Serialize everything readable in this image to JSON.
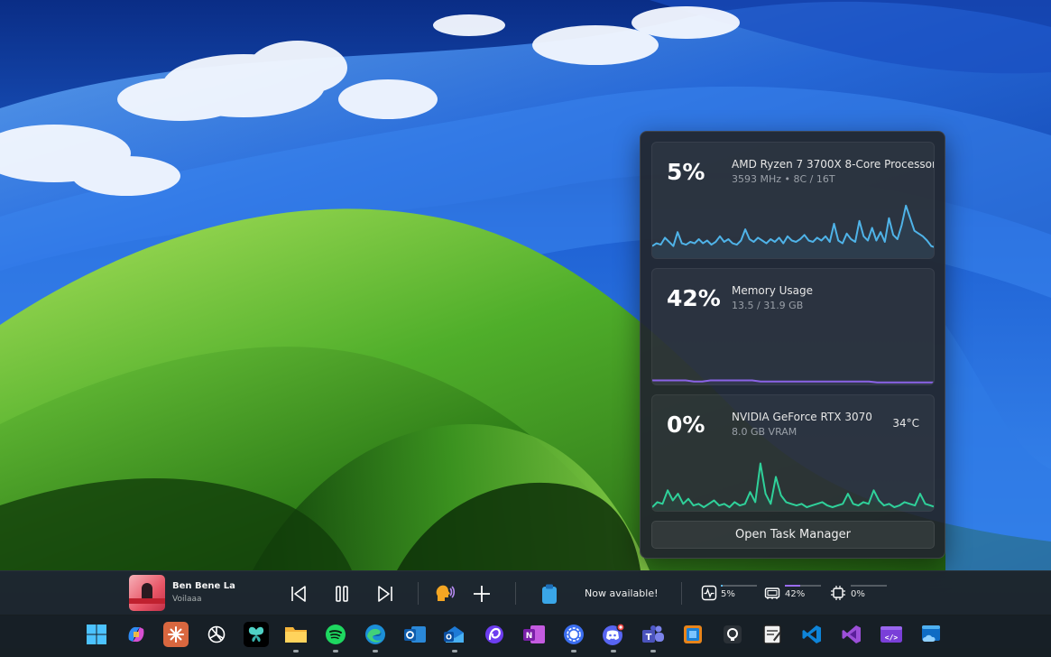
{
  "colors": {
    "cpu_line": "#4fb3e8",
    "mem_line": "#8a63e6",
    "gpu_line": "#2fd19a",
    "accent": "#5bb7f0"
  },
  "performance": {
    "cpu": {
      "percent": "5%",
      "name": "AMD Ryzen 7 3700X 8-Core Processor",
      "details": "3593 MHz  •  8C / 16T",
      "history": [
        6,
        8,
        7,
        12,
        9,
        6,
        16,
        8,
        7,
        9,
        8,
        11,
        8,
        10,
        7,
        9,
        13,
        9,
        11,
        8,
        7,
        10,
        18,
        11,
        9,
        12,
        10,
        8,
        11,
        9,
        12,
        8,
        13,
        10,
        9,
        11,
        14,
        10,
        9,
        12,
        10,
        13,
        9,
        22,
        10,
        8,
        15,
        11,
        9,
        24,
        13,
        10,
        19,
        10,
        16,
        9,
        26,
        14,
        11,
        21,
        35,
        26,
        17,
        15,
        13,
        10,
        6,
        5
      ]
    },
    "memory": {
      "percent": "42%",
      "name": "Memory Usage",
      "details": "13.5 / 31.9 GB",
      "history": [
        42,
        42,
        42,
        42,
        42,
        41,
        41,
        42,
        42,
        42,
        42,
        42,
        42,
        41,
        41,
        41,
        41,
        41,
        41,
        41,
        41,
        41,
        41,
        41,
        41,
        41,
        41,
        40,
        40,
        40,
        40,
        40,
        40,
        40,
        40
      ]
    },
    "gpu": {
      "percent": "0%",
      "name": "NVIDIA GeForce RTX 3070",
      "details": "8.0 GB VRAM",
      "temperature": "34°C",
      "history": [
        0,
        3,
        2,
        10,
        4,
        8,
        2,
        5,
        1,
        2,
        0,
        2,
        4,
        1,
        2,
        0,
        3,
        1,
        2,
        9,
        3,
        26,
        8,
        2,
        18,
        7,
        3,
        2,
        1,
        2,
        0,
        1,
        2,
        3,
        1,
        0,
        1,
        2,
        8,
        2,
        1,
        3,
        2,
        10,
        4,
        1,
        2,
        0,
        1,
        3,
        2,
        1,
        8,
        2,
        1,
        0
      ]
    },
    "open_task_manager_label": "Open Task Manager"
  },
  "widgetbar": {
    "media": {
      "title": "Ben Bene La",
      "artist": "Voilaaa",
      "prev_icon": "skip-previous-icon",
      "pause_icon": "pause-icon",
      "next_icon": "skip-next-icon"
    },
    "notification_text": "Now available!",
    "stats": [
      {
        "icon": "activity-icon",
        "value": "5%",
        "fill": 0.05
      },
      {
        "icon": "memory-icon",
        "value": "42%",
        "fill": 0.42
      },
      {
        "icon": "chip-icon",
        "value": "0%",
        "fill": 0.0
      }
    ]
  },
  "taskbar": {
    "apps": [
      {
        "name": "start-button",
        "icon": "windows-icon"
      },
      {
        "name": "copilot",
        "icon": "copilot-icon"
      },
      {
        "name": "claude",
        "icon": "claude-icon"
      },
      {
        "name": "chatgpt",
        "icon": "chatgpt-icon"
      },
      {
        "name": "butterfly-app",
        "icon": "butterfly-icon"
      },
      {
        "name": "file-explorer",
        "icon": "folder-icon"
      },
      {
        "name": "spotify",
        "icon": "spotify-icon"
      },
      {
        "name": "edge",
        "icon": "edge-icon"
      },
      {
        "name": "outlook",
        "icon": "outlook-icon"
      },
      {
        "name": "outlook-new",
        "icon": "outlook-new-icon"
      },
      {
        "name": "arc",
        "icon": "arc-icon"
      },
      {
        "name": "onenote",
        "icon": "onenote-icon"
      },
      {
        "name": "signal",
        "icon": "signal-icon"
      },
      {
        "name": "discord",
        "icon": "discord-icon"
      },
      {
        "name": "teams",
        "icon": "teams-icon"
      },
      {
        "name": "remote-desktop",
        "icon": "remote-desktop-icon"
      },
      {
        "name": "github-desktop",
        "icon": "github-icon"
      },
      {
        "name": "notepad",
        "icon": "notepad-icon"
      },
      {
        "name": "vscode",
        "icon": "vscode-icon"
      },
      {
        "name": "visual-studio",
        "icon": "visual-studio-icon"
      },
      {
        "name": "dev-home",
        "icon": "dev-home-icon"
      },
      {
        "name": "azure-tool",
        "icon": "cloud-window-icon"
      }
    ]
  }
}
